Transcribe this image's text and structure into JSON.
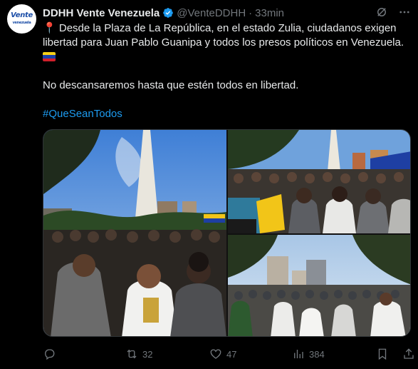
{
  "author": {
    "name": "DDHH Vente Venezuela",
    "handle": "@VenteDDHH",
    "separator": "·",
    "time": "33min",
    "avatar_text": "Vente",
    "avatar_subtext": "venezuela"
  },
  "tweet": {
    "pin_emoji": "📍",
    "line1": "Desde la Plaza de La República, en el estado Zulia, ciudadanos exigen libertad para Juan Pablo Guanipa y todos los presos políticos en Venezuela.",
    "line2": "No descansaremos hasta que estén todos en libertad.",
    "hashtag": "#QueSeanTodos"
  },
  "actions": {
    "replies": "",
    "retweets": "32",
    "likes": "47",
    "views": "384"
  },
  "colors": {
    "background": "#000000",
    "text": "#e7e9ea",
    "muted": "#71767b",
    "link": "#1d9bf0",
    "verified": "#1d9bf0",
    "flag_yellow": "#f7d117",
    "flag_blue": "#1a3fa8",
    "flag_red": "#d11f2b"
  },
  "icons": [
    "verified-badge-icon",
    "grok-icon",
    "more-icon",
    "reply-icon",
    "retweet-icon",
    "like-icon",
    "views-icon",
    "bookmark-icon",
    "share-icon",
    "pin-icon",
    "venezuela-flag-icon"
  ]
}
